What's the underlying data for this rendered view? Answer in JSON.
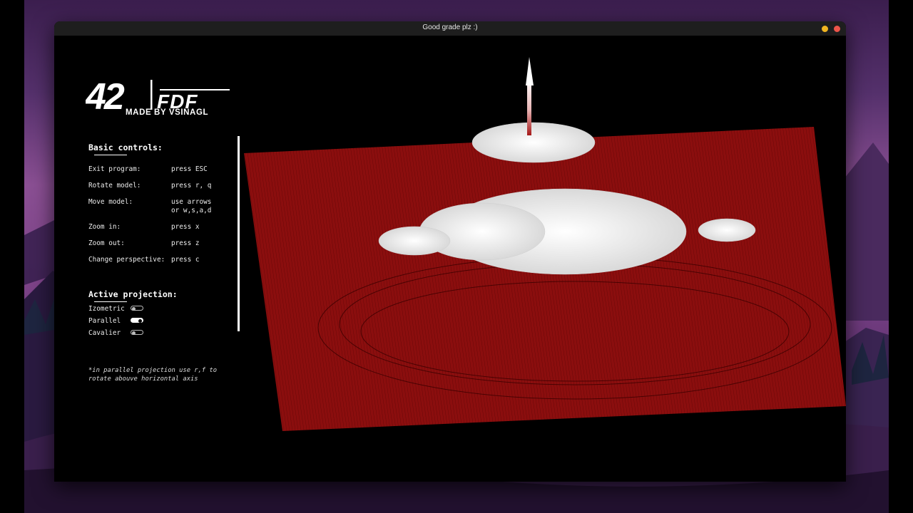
{
  "window": {
    "title": "Good grade plz :)",
    "controls": [
      "minimize",
      "close"
    ]
  },
  "logo": {
    "number": "42",
    "product": "FDF",
    "tagline": "MADE BY VSINAGL"
  },
  "basic_controls": {
    "title": "Basic controls:",
    "items": [
      {
        "label": "Exit program:",
        "value": "press ESC"
      },
      {
        "label": "Rotate model:",
        "value": "press r, q"
      },
      {
        "label": "Move model:",
        "value": "use arrows\nor w,s,a,d"
      },
      {
        "label": "Zoom in:",
        "value": "press x"
      },
      {
        "label": "Zoom out:",
        "value": "press z"
      },
      {
        "label": "Change perspective:",
        "value": "press c"
      }
    ]
  },
  "active_projection": {
    "title": "Active projection:",
    "options": [
      {
        "label": "Izometric",
        "active": false
      },
      {
        "label": "Parallel",
        "active": true
      },
      {
        "label": "Cavalier",
        "active": false
      }
    ]
  },
  "footnote": {
    "line1": "*in parallel projection use r,f to",
    "line2": "rotate abouve horizontal axis"
  },
  "colors": {
    "background": "#000000",
    "plane": "#8b0e0e",
    "plane_lines": "#5c0606",
    "peak": "#ffffff",
    "base": "#a51818",
    "titlebar": "#1e1e1e",
    "minimize": "#f1b521",
    "close": "#ec544a"
  },
  "icons": [
    "minimize-icon",
    "close-icon",
    "toggle-icon"
  ]
}
